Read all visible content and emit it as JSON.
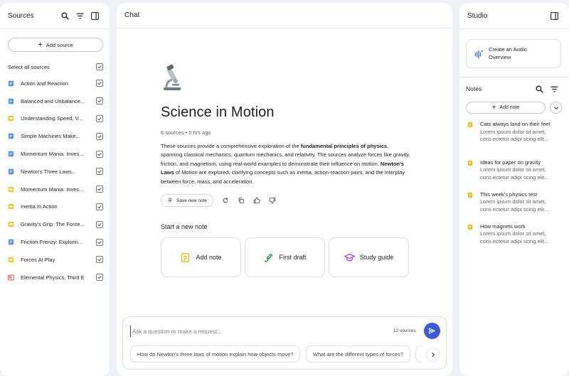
{
  "sources_panel": {
    "title": "Sources",
    "add_source_label": "Add source",
    "select_all_label": "Select all sources",
    "items": [
      {
        "label": "Action and Reaction",
        "type": "doc",
        "color": "#4285f4"
      },
      {
        "label": "Balanced and Unbalance...",
        "type": "doc",
        "color": "#4285f4"
      },
      {
        "label": "Understanding Speed, V...",
        "type": "slides",
        "color": "#fbbc04"
      },
      {
        "label": "Simple Machines Make...",
        "type": "doc",
        "color": "#4285f4"
      },
      {
        "label": "Momentum Mania: Inves...",
        "type": "doc",
        "color": "#4285f4"
      },
      {
        "label": "Newton's Three Laws...",
        "type": "doc",
        "color": "#4285f4"
      },
      {
        "label": "Momentum Mania: Inves...",
        "type": "slides",
        "color": "#fbbc04"
      },
      {
        "label": "Inertia In Action",
        "type": "slides",
        "color": "#fbbc04"
      },
      {
        "label": "Gravity's Grip: The Force...",
        "type": "slides",
        "color": "#fbbc04"
      },
      {
        "label": "Friction Frenzy: Explorin...",
        "type": "doc",
        "color": "#4285f4"
      },
      {
        "label": "Forces At Play",
        "type": "slides",
        "color": "#fbbc04"
      },
      {
        "label": "Elemental Physics, Third E",
        "type": "pdf",
        "color": "#ea4335"
      }
    ]
  },
  "chat_panel": {
    "title": "Chat",
    "emoji_icon": "microscope-icon",
    "notebook_title": "Science in Motion",
    "meta": "6 sources • 5 hrs ago",
    "summary_parts": {
      "p1": "These sources provide a comprehensive exploration of the ",
      "b1": "fundamental principles of physics",
      "p2": ", spanning classical mechanics, quantum mechanics, and relativity. The sources analyze forces like gravity, friction, and magnetism, using real-world examples to demonstrate their influence on motion. ",
      "b2": "Newton's Laws",
      "p3": " of Motion are explored, clarifying concepts such as inertia, action-reaction pairs, and the interplay between force, mass, and acceleration."
    },
    "save_note_label": "Save new note",
    "start_note_label": "Start a new note",
    "cards": [
      {
        "label": "Add note",
        "icon": "note-icon",
        "color": "#f4b400"
      },
      {
        "label": "First draft",
        "icon": "draft-icon",
        "color": "#1e8e3e"
      },
      {
        "label": "Study guide",
        "icon": "graduation-cap-icon",
        "color": "#a142f4"
      }
    ],
    "composer": {
      "placeholder": "Ask a question or make a request...",
      "source_count": "12 sources"
    },
    "suggestions": [
      "How do Newton's three laws of motion explain how objects move?",
      "What are the different types of forces?"
    ]
  },
  "studio_panel": {
    "title": "Studio",
    "audio_overview_line1": "Create an Audio",
    "audio_overview_line2": "Overview",
    "notes_title": "Notes",
    "add_note_label": "Add note",
    "notes": [
      {
        "title": "Cats always land on their feet",
        "preview": "Lorem ipsum dolor sit amet, cons ectetur adipi scing elit..."
      },
      {
        "title": "Ideas for paper on gravity",
        "preview": "Lorem ipsum dolor sit amet, cons ectetur adipi scing elit..."
      },
      {
        "title": "This week's physics test",
        "preview": "Lorem ipsum dolor sit amet, cons ectetur adipi scing elit..."
      },
      {
        "title": "How magnets work",
        "preview": "Lorem ipsum dolor sit amet, cons ectetur adipi scing elit..."
      }
    ]
  },
  "colors": {
    "accent": "#3b5bdb",
    "background": "#eef1f5",
    "note_icon": "#f4b400"
  }
}
